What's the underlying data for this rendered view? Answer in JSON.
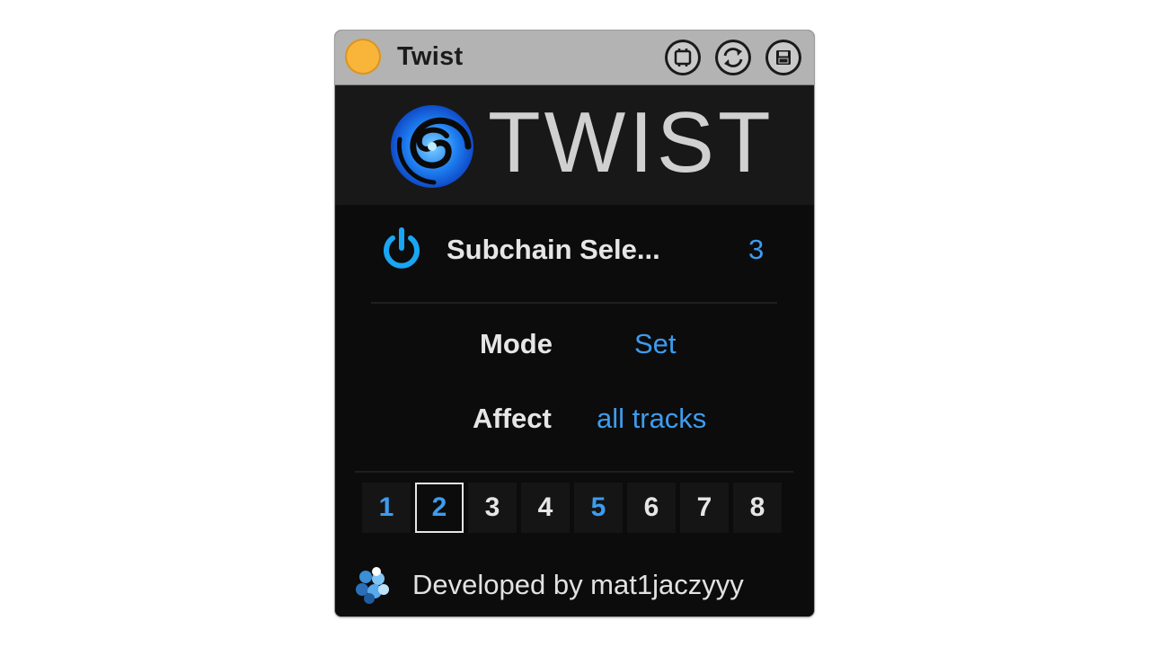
{
  "device": {
    "title": "Twist",
    "titlebar_icons": [
      "map-icon",
      "hot-swap-icon",
      "save-preset-icon"
    ]
  },
  "logo": {
    "wordmark": "TWIST",
    "icon": "swirl-logo-icon"
  },
  "parameters": {
    "subchain": {
      "label": "Subchain Sele...",
      "value": "3",
      "enabled": true
    },
    "mode": {
      "label": "Mode",
      "value": "Set"
    },
    "affect": {
      "label": "Affect",
      "value": "all tracks"
    }
  },
  "slots": {
    "labels": [
      "1",
      "2",
      "3",
      "4",
      "5",
      "6",
      "7",
      "8"
    ],
    "selected": "2",
    "highlighted": [
      "1",
      "2",
      "5"
    ]
  },
  "footer": {
    "text": "Developed by mat1jaczyyy",
    "icon": "developer-logo-icon"
  },
  "colors": {
    "accent": "#3d9cef",
    "device_bg": "#0c0c0c",
    "titlebar_bg": "#b3b3b3",
    "device_on": "#f9b43a"
  }
}
